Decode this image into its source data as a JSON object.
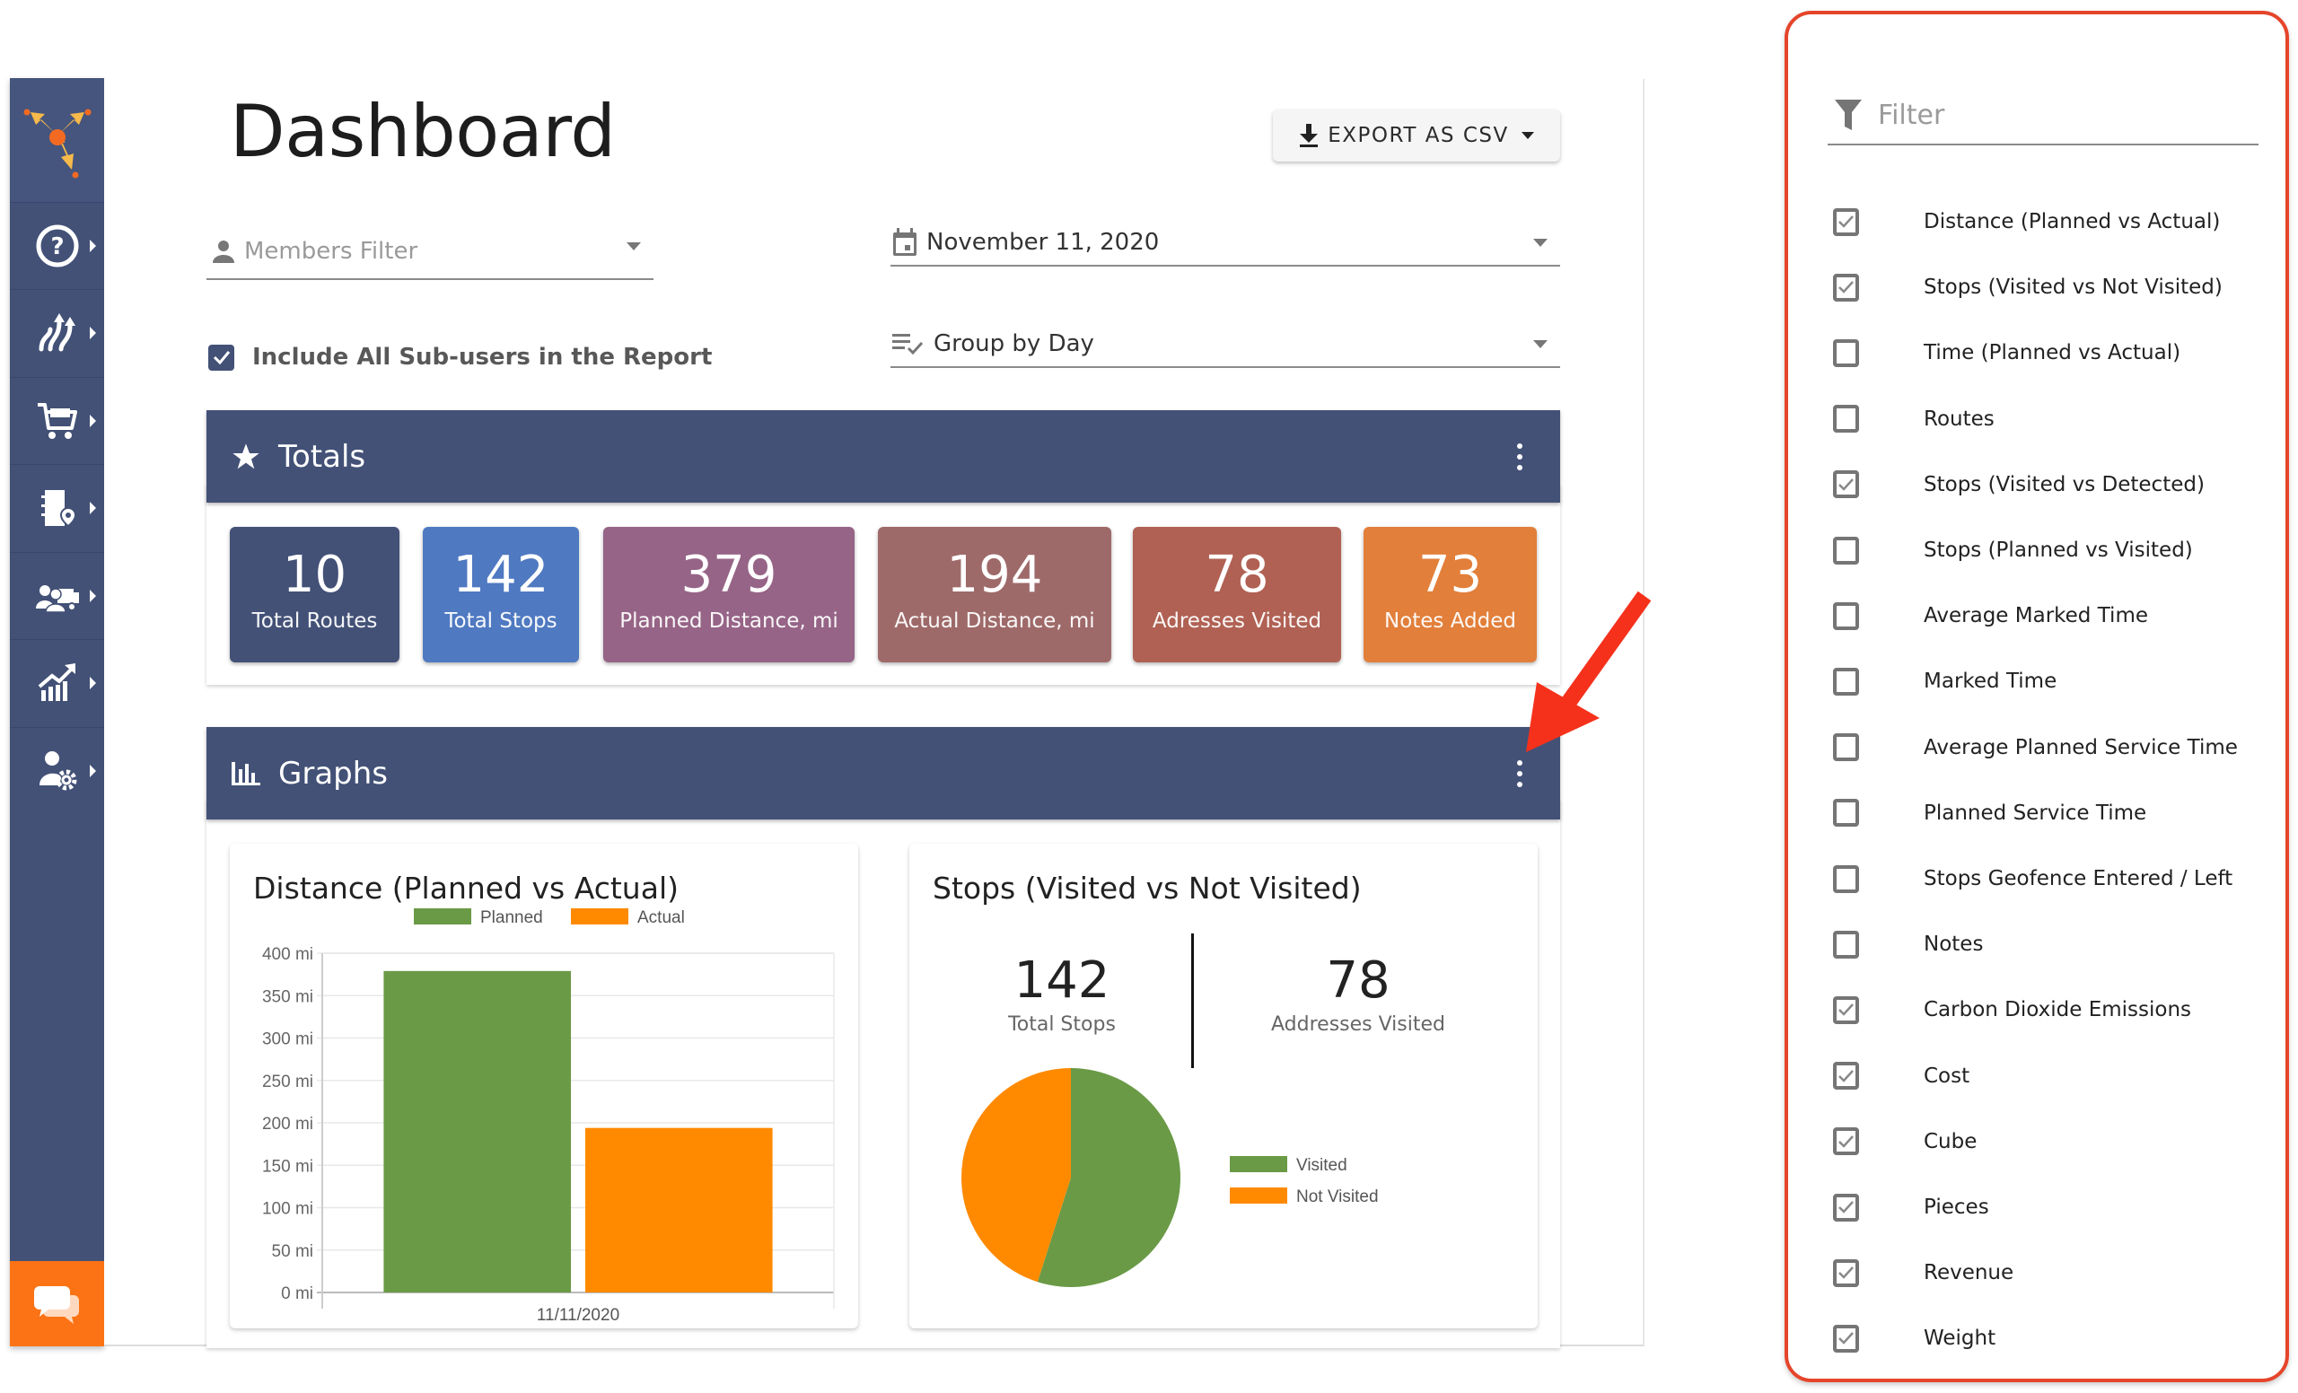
{
  "sidebar": {
    "logo": "route4me-logo",
    "items": [
      {
        "name": "help",
        "icon": "help-circle-icon"
      },
      {
        "name": "routes",
        "icon": "routes-icon"
      },
      {
        "name": "orders",
        "icon": "shopping-cart-icon"
      },
      {
        "name": "address-book",
        "icon": "address-book-icon"
      },
      {
        "name": "team-vehicles",
        "icon": "team-vehicle-icon"
      },
      {
        "name": "analytics",
        "icon": "analytics-chart-icon"
      },
      {
        "name": "user-settings",
        "icon": "user-settings-icon"
      }
    ],
    "chat_icon": "chat-icon",
    "colors": {
      "background": "#435177",
      "chat": "#fb7314"
    }
  },
  "header": {
    "title": "Dashboard",
    "export_label": "EXPORT AS CSV"
  },
  "filters": {
    "members_placeholder": "Members Filter",
    "date_value": "November 11, 2020",
    "group_by_value": "Group by Day",
    "include_subusers_label": "Include All Sub-users in the Report",
    "include_subusers_checked": true
  },
  "totals": {
    "title": "Totals",
    "tiles": [
      {
        "value": "10",
        "label": "Total Routes",
        "color": "#435177"
      },
      {
        "value": "142",
        "label": "Total Stops",
        "color": "#4f79c1"
      },
      {
        "value": "379",
        "label": "Planned Distance, mi",
        "color": "#966486"
      },
      {
        "value": "194",
        "label": "Actual Distance, mi",
        "color": "#9e6a69"
      },
      {
        "value": "78",
        "label": "Adresses Visited",
        "color": "#b06153"
      },
      {
        "value": "73",
        "label": "Notes Added",
        "color": "#e27f3a"
      }
    ]
  },
  "graphs": {
    "title": "Graphs",
    "distance_card": {
      "title": "Distance (Planned vs Actual)"
    },
    "stops_card": {
      "title": "Stops (Visited vs Not Visited)",
      "total_stops_value": "142",
      "total_stops_label": "Total Stops",
      "visited_value": "78",
      "visited_label": "Addresses Visited"
    }
  },
  "chart_data": [
    {
      "type": "bar",
      "title": "Distance (Planned vs Actual)",
      "categories": [
        "11/11/2020"
      ],
      "series": [
        {
          "name": "Planned",
          "values": [
            379
          ],
          "color": "#6a9a46"
        },
        {
          "name": "Actual",
          "values": [
            194
          ],
          "color": "#ff8a00"
        }
      ],
      "xlabel": "",
      "ylabel": "",
      "ylim": [
        0,
        400
      ],
      "yticks": [
        0,
        50,
        100,
        150,
        200,
        250,
        300,
        350,
        400
      ],
      "ytick_suffix": " mi",
      "grid": true,
      "legend": "top"
    },
    {
      "type": "pie",
      "title": "Stops (Visited vs Not Visited)",
      "slices": [
        {
          "label": "Visited",
          "value": 78,
          "color": "#6a9a46"
        },
        {
          "label": "Not Visited",
          "value": 64,
          "color": "#ff8a00"
        }
      ],
      "legend": "right"
    }
  ],
  "filter_panel": {
    "placeholder": "Filter",
    "items": [
      {
        "label": "Distance (Planned vs Actual)",
        "checked": true
      },
      {
        "label": "Stops (Visited vs Not Visited)",
        "checked": true
      },
      {
        "label": "Time (Planned vs Actual)",
        "checked": false
      },
      {
        "label": "Routes",
        "checked": false
      },
      {
        "label": "Stops (Visited vs Detected)",
        "checked": true
      },
      {
        "label": "Stops (Planned vs Visited)",
        "checked": false
      },
      {
        "label": "Average Marked Time",
        "checked": false
      },
      {
        "label": "Marked Time",
        "checked": false
      },
      {
        "label": "Average Planned Service Time",
        "checked": false
      },
      {
        "label": "Planned Service Time",
        "checked": false
      },
      {
        "label": "Stops Geofence Entered / Left",
        "checked": false
      },
      {
        "label": "Notes",
        "checked": false
      },
      {
        "label": "Carbon Dioxide Emissions",
        "checked": true
      },
      {
        "label": "Cost",
        "checked": true
      },
      {
        "label": "Cube",
        "checked": true
      },
      {
        "label": "Pieces",
        "checked": true
      },
      {
        "label": "Revenue",
        "checked": true
      },
      {
        "label": "Weight",
        "checked": true
      }
    ],
    "border_color": "#e5452b"
  },
  "annotation": {
    "arrow_color": "#f5311b",
    "points_to": "graphs-menu-button"
  }
}
